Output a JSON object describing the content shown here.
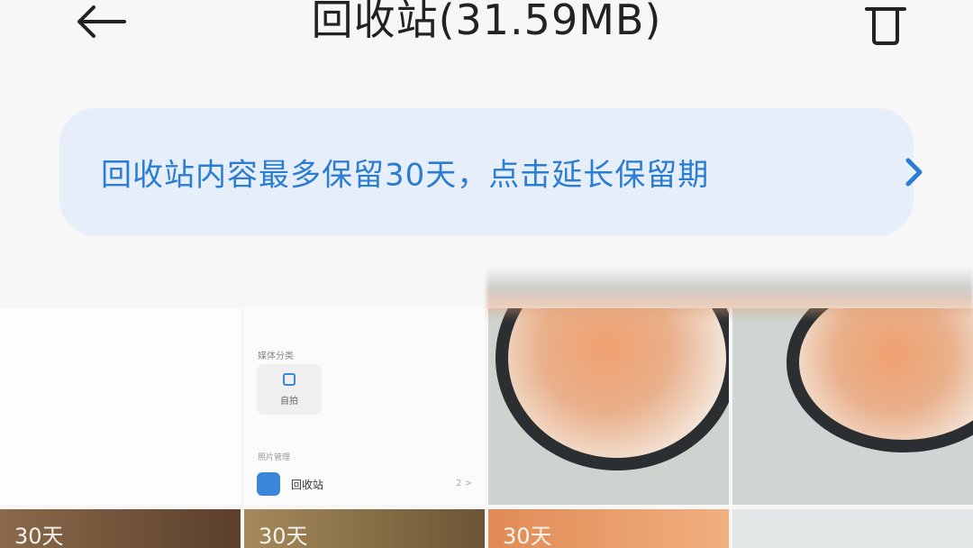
{
  "header": {
    "title": "回收站(31.59MB)",
    "back_icon": "back-arrow-icon",
    "trash_icon": "trash-icon"
  },
  "notice": {
    "text": "回收站内容最多保留30天，点击延长保留期",
    "arrow_icon": "chevron-right-icon",
    "color": "#2b7cd3",
    "background": "#e6eff9"
  },
  "tiles": [
    {
      "kind": "blank-screenshot"
    },
    {
      "kind": "app-screenshot",
      "category_label": "媒体分类",
      "card_label": "自拍",
      "section_label": "照片管理",
      "bin_label": "回收站",
      "bin_count": "2 >"
    },
    {
      "kind": "food-photo"
    },
    {
      "kind": "food-photo"
    },
    {
      "kind": "photo",
      "days_left": "30天"
    },
    {
      "kind": "photo",
      "days_left": "30天"
    },
    {
      "kind": "photo",
      "days_left": "30天"
    },
    {
      "kind": "photo",
      "days_left": ""
    }
  ]
}
